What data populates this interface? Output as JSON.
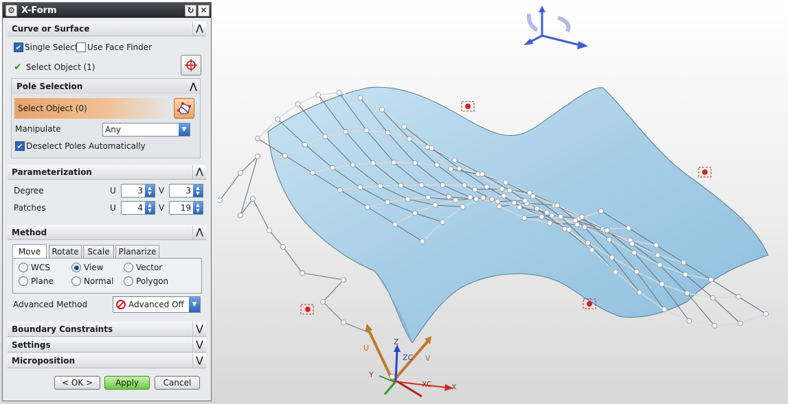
{
  "dialog": {
    "title": "X-Form",
    "icons": {
      "settings": "gear-icon",
      "reset": "reset-icon",
      "close": "close-icon"
    }
  },
  "curve_or_surface": {
    "header": "Curve or Surface",
    "single_select": {
      "label": "Single Select",
      "checked": true
    },
    "use_face_finder": {
      "label": "Use Face Finder",
      "checked": false
    },
    "select_object": "Select Object (1)"
  },
  "pole_selection": {
    "header": "Pole Selection",
    "select_object": "Select Object (0)",
    "manipulate_label": "Manipulate",
    "manipulate_value": "Any",
    "deselect_poles": {
      "label": "Deselect Poles Automatically",
      "checked": true
    }
  },
  "parameterization": {
    "header": "Parameterization",
    "degree_label": "Degree",
    "patches_label": "Patches",
    "u_label": "U",
    "v_label": "V",
    "degree_u": "3",
    "degree_v": "3",
    "patches_u": "4",
    "patches_v": "19"
  },
  "method": {
    "header": "Method",
    "tabs": [
      "Move",
      "Rotate",
      "Scale",
      "Planarize"
    ],
    "active_tab": "Move",
    "radios": [
      "WCS",
      "View",
      "Vector",
      "Plane",
      "Normal",
      "Polygon"
    ],
    "selected_radio": "View",
    "advanced_label": "Advanced Method",
    "advanced_value": "Advanced Off"
  },
  "collapsed_groups": [
    "Boundary Constraints",
    "Settings",
    "Microposition"
  ],
  "buttons": {
    "ok": "< OK >",
    "apply": "Apply",
    "cancel": "Cancel"
  },
  "viewport": {
    "axis_labels": {
      "u": "U",
      "v": "V",
      "z": "Z",
      "y": "Y",
      "x": "X",
      "zc": "ZC",
      "xc": "XC"
    },
    "colors": {
      "surface": "#a9cfe6",
      "pole": "#ffffff",
      "handle": "#d32424",
      "accent": "#3d5fd0"
    }
  }
}
